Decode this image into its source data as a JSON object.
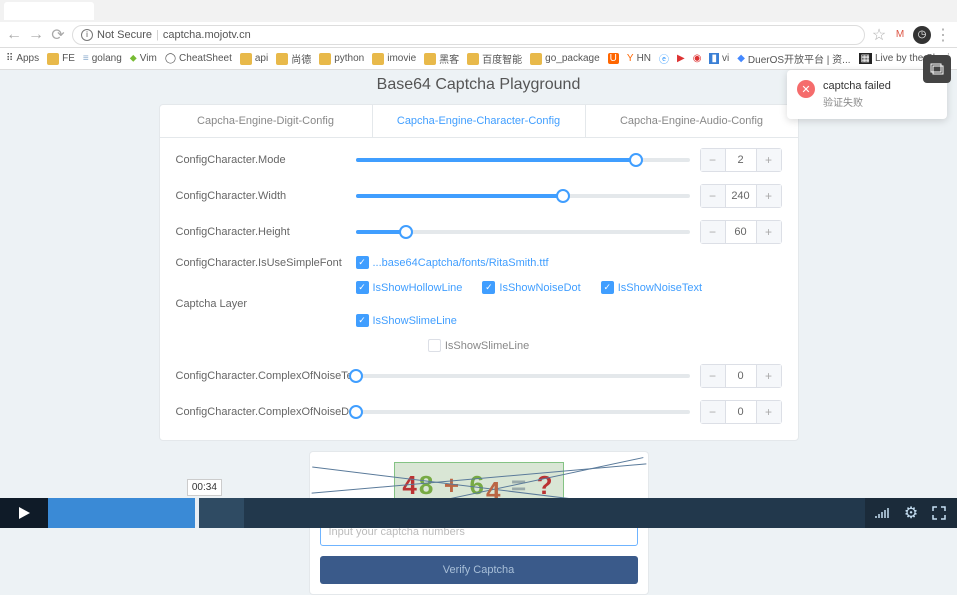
{
  "browser": {
    "not_secure": "Not Secure",
    "url": "captcha.mojotv.cn",
    "bookmarks": [
      "Apps",
      "FE",
      "golang",
      "Vim",
      "CheatSheet",
      "api",
      "尚德",
      "python",
      "imovie",
      "黑客",
      "百度智能",
      "go_package",
      "HN",
      "vi",
      "DuerOS开放平台 | 资...",
      "Live by the Shuri"
    ]
  },
  "page_title": "Base64 Captcha Playground",
  "tabs": {
    "digit": "Capcha-Engine-Digit-Config",
    "char": "Capcha-Engine-Character-Config",
    "audio": "Capcha-Engine-Audio-Config"
  },
  "labels": {
    "mode": "ConfigCharacter.Mode",
    "width": "ConfigCharacter.Width",
    "height": "ConfigCharacter.Height",
    "simplefont": "ConfigCharacter.IsUseSimpleFont",
    "layer": "Captcha Layer",
    "noisetext": "ConfigCharacter.ComplexOfNoiseText",
    "noisedot": "ConfigCharacter.ComplexOfNoiseDot"
  },
  "values": {
    "mode": "2",
    "width": "240",
    "height": "60",
    "noisetext": "0",
    "noisedot": "0"
  },
  "font_path": "...base64Captcha/fonts/RitaSmith.ttf",
  "layer_opts": {
    "hollow": "IsShowHollowLine",
    "noisedot": "IsShowNoiseDot",
    "noisetext": "IsShowNoiseText",
    "slime": "IsShowSlimeLine",
    "slime2": "IsShowSlimeLine"
  },
  "captcha": {
    "expr_parts": [
      "4",
      "8",
      "+",
      "6",
      "4",
      "=",
      "?"
    ],
    "placeholder": "Input your captcha numbers",
    "verify_btn": "Verify Captcha"
  },
  "toast": {
    "title": "captcha failed",
    "sub": "验证失败"
  },
  "video": {
    "time": "00:34"
  }
}
